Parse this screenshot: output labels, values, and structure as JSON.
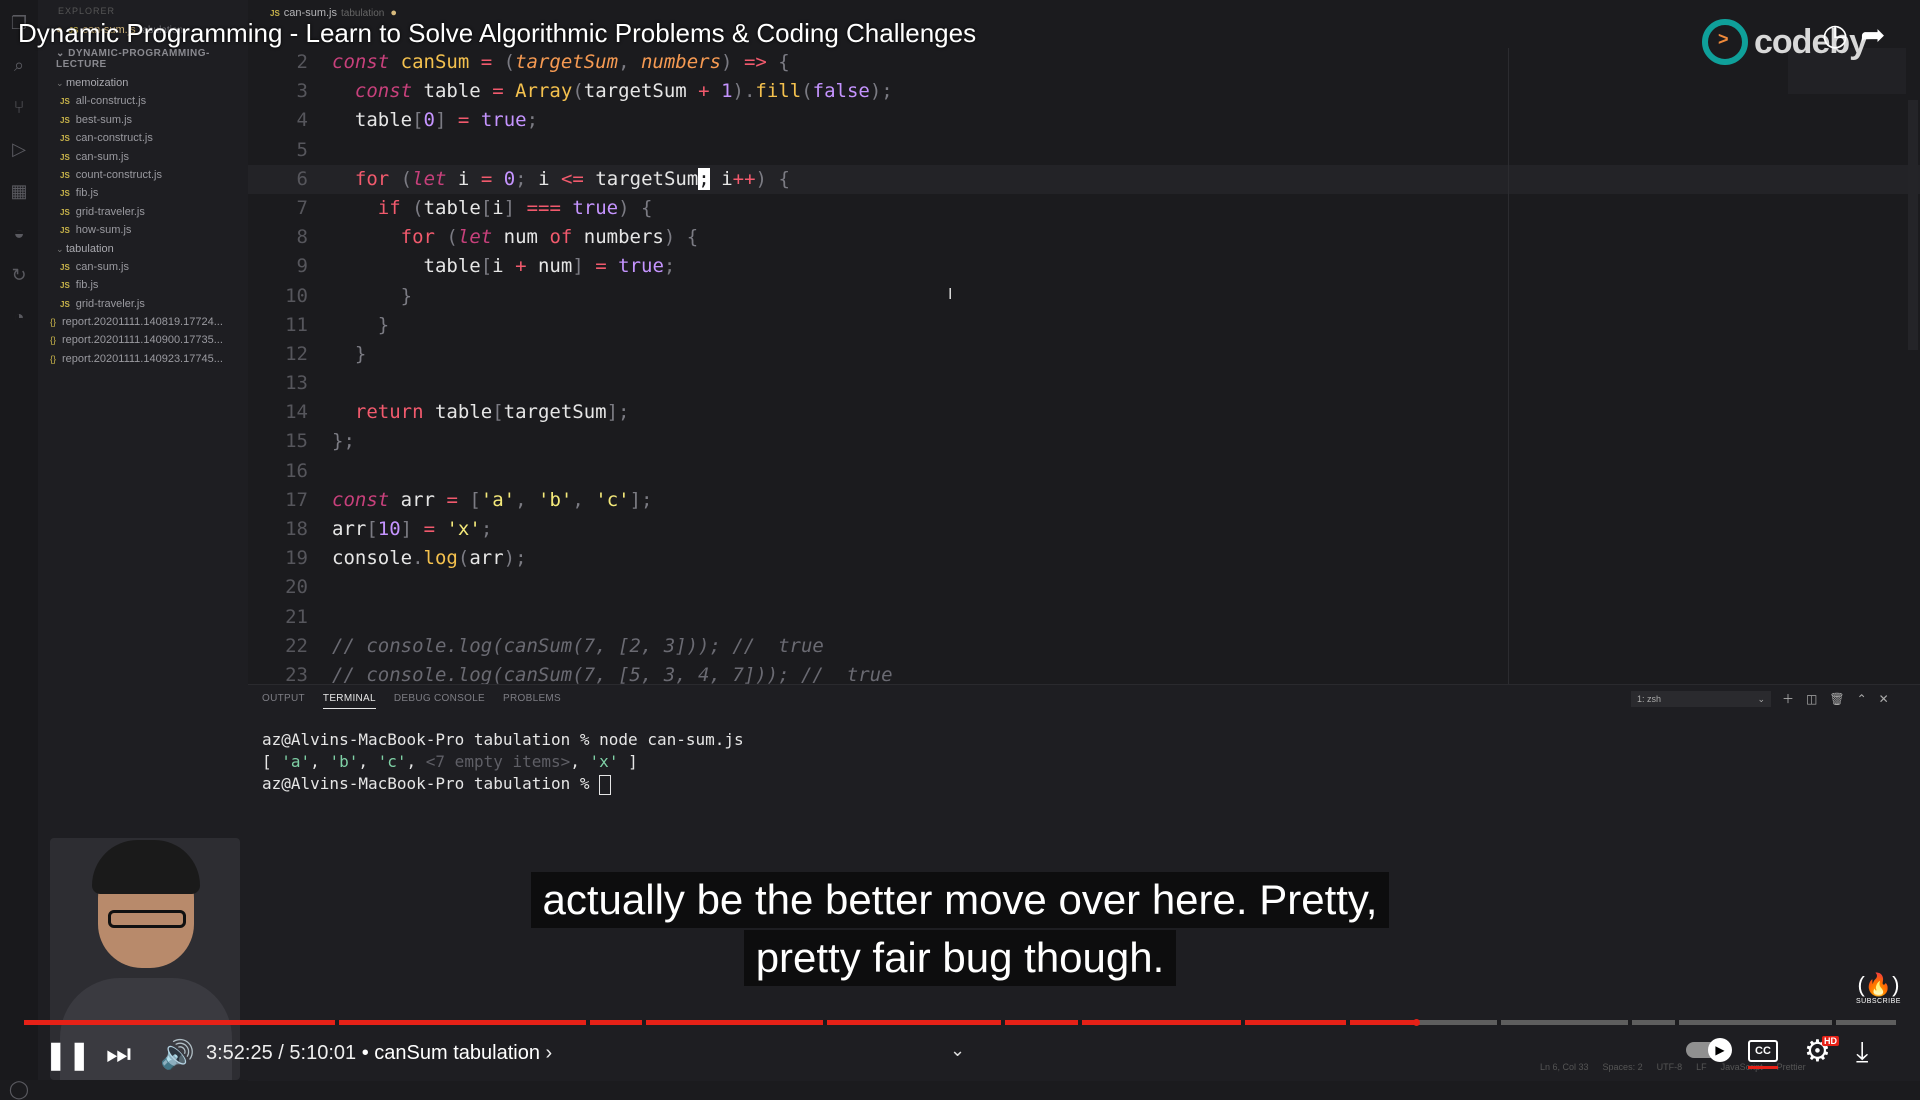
{
  "video": {
    "title": "Dynamic Programming - Learn to Solve Algorithmic Problems & Coding Challenges",
    "channel_logo_text": "codeby",
    "captions": [
      "actually be the better move over here. Pretty,",
      "pretty fair bug though."
    ],
    "current_time": "3:52:25",
    "duration": "5:10:01",
    "time_separator": "/",
    "chapter_label": "• canSum tabulation",
    "chapter_arrow": "›",
    "progress_fraction": 0.7434,
    "chapter_breaks": [
      0.166,
      0.3,
      0.33,
      0.427,
      0.522,
      0.563,
      0.65,
      0.706,
      0.787,
      0.857,
      0.882,
      0.966
    ],
    "subscribe_label": "SUBSCRIBE",
    "hd_badge": "HD",
    "cc_label": "CC"
  },
  "editor": {
    "tab": {
      "filename": "can-sum.js",
      "folder_hint": "tabulation",
      "modified_dot": "●"
    },
    "explorer_header": "EXPLORER",
    "open_editor": {
      "filename": "can-sum.js",
      "folder_hint": "tabulation"
    },
    "project_name": "DYNAMIC-PROGRAMMING-LECTURE",
    "folders": [
      {
        "name": "memoization",
        "files": [
          "all-construct.js",
          "best-sum.js",
          "can-construct.js",
          "can-sum.js",
          "count-construct.js",
          "fib.js",
          "grid-traveler.js",
          "how-sum.js"
        ]
      },
      {
        "name": "tabulation",
        "files": [
          "can-sum.js",
          "fib.js",
          "grid-traveler.js"
        ]
      }
    ],
    "json_files": [
      "report.20201111.140819.17724...",
      "report.20201111.140900.17735...",
      "report.20201111.140923.17745..."
    ],
    "line_numbers": [
      "2",
      "3",
      "4",
      "5",
      "6",
      "7",
      "8",
      "9",
      "10",
      "11",
      "12",
      "13",
      "14",
      "15",
      "16",
      "17",
      "18",
      "19",
      "20",
      "21",
      "22",
      "23"
    ],
    "current_line_index": 4
  },
  "panel": {
    "tabs": [
      "OUTPUT",
      "TERMINAL",
      "DEBUG CONSOLE",
      "PROBLEMS"
    ],
    "active_tab": "TERMINAL",
    "terminal_select": "1: zsh",
    "terminal_lines": {
      "prompt": "az@Alvins-MacBook-Pro tabulation % ",
      "command": "node can-sum.js",
      "open": "[ ",
      "a": "'a'",
      "b": "'b'",
      "c": "'c'",
      "empty": "<7 empty items>",
      "x": "'x'",
      "close": " ]",
      "sep": ", "
    }
  },
  "status_bar": [
    "Ln 6, Col 33",
    "Spaces: 2",
    "UTF-8",
    "LF",
    "JavaScript",
    "Prettier"
  ],
  "colors": {
    "progress_red": "#e62117",
    "keyword": "#f25a6d",
    "storage": "#c7407b",
    "function": "#f4c14e",
    "param": "#f69a52",
    "literal": "#c594ff",
    "string": "#f4e97a"
  }
}
